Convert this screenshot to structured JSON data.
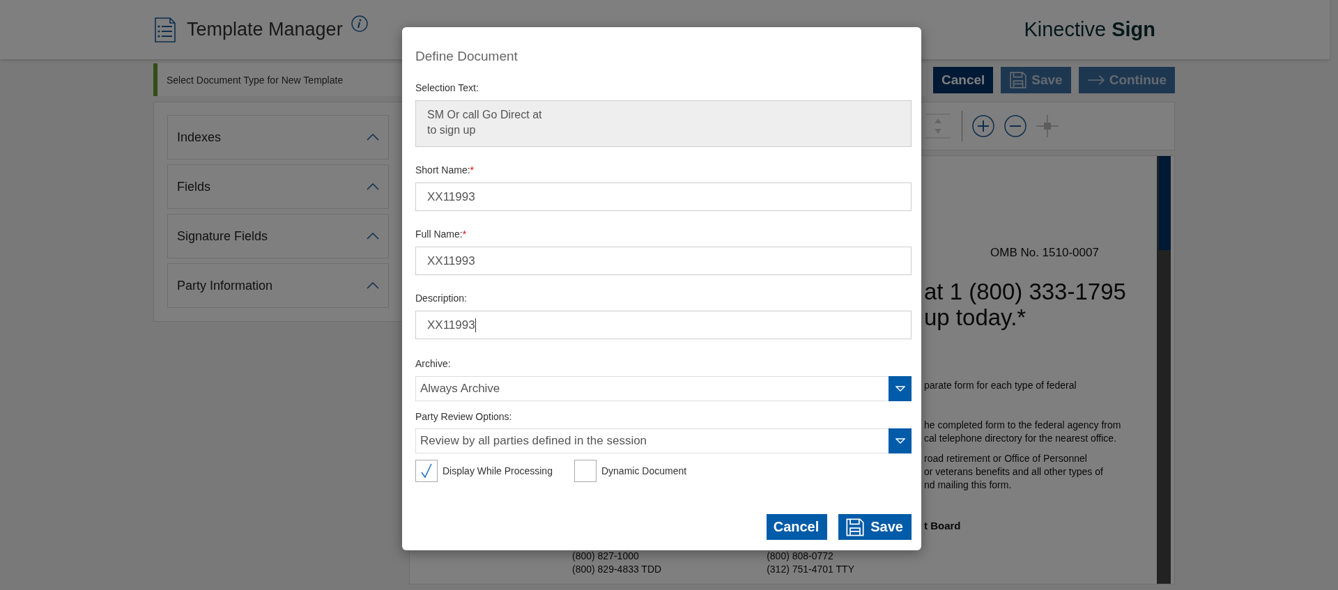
{
  "header": {
    "title": "Template Manager",
    "logo": {
      "light": "Kinective",
      "bold": "Sign"
    }
  },
  "step_bar": {
    "text": "Select Document Type for New Template"
  },
  "actions": [
    {
      "label": "Cancel",
      "kind": "cancel",
      "disabled": false
    },
    {
      "label": "Save",
      "kind": "save",
      "disabled": true
    },
    {
      "label": "Continue",
      "kind": "continue",
      "disabled": true
    }
  ],
  "sidebar": {
    "sections": [
      {
        "label": "Indexes",
        "expanded": true
      },
      {
        "label": "Fields",
        "expanded": true
      },
      {
        "label": "Signature Fields",
        "expanded": true
      },
      {
        "label": "Party Information",
        "expanded": true
      }
    ]
  },
  "document": {
    "lines": [
      {
        "kind": "omb",
        "text": "OMB No. 1510-0007"
      },
      {
        "kind": "heading",
        "text": "at 1 (800) 333-1795"
      },
      {
        "kind": "heading",
        "text": "up today.*"
      },
      {
        "kind": "body",
        "text": "parate form for each type of federal"
      },
      {
        "kind": "gap",
        "text": "he completed form to the federal agency from"
      },
      {
        "kind": "body",
        "text": "cal telephone directory for the nearest office."
      },
      {
        "kind": "para",
        "text": "road retirement or Office of Personnel"
      },
      {
        "kind": "body",
        "text": "or veterans benefits and all other types of"
      },
      {
        "kind": "body",
        "text": "nd mailing this form."
      },
      {
        "kind": "bold",
        "text": "t Board"
      }
    ],
    "contacts": [
      {
        "lines": [
          "(800) 827-1000",
          "(800) 829-4833 TDD"
        ]
      },
      {
        "lines": [
          "(800) 808-0772",
          "(312) 751-4701 TTY"
        ]
      }
    ]
  },
  "dialog": {
    "title": "Define Document",
    "fields": [
      {
        "kind": "readonly",
        "label": "Selection Text:",
        "value": "SM Or call Go Direct at\nto sign up"
      },
      {
        "kind": "text",
        "label": "Short Name:",
        "required_mark": "*",
        "value": "XX11993",
        "focused": false
      },
      {
        "kind": "text",
        "label": "Full Name:",
        "required_mark": "*",
        "value": "XX11993",
        "focused": false
      },
      {
        "kind": "text",
        "label": "Description:",
        "value": "XX11993",
        "focused": true
      },
      {
        "kind": "select",
        "label": "Archive:",
        "value": "Always Archive"
      },
      {
        "kind": "select",
        "label": "Party Review Options:",
        "value": "Review by all parties defined in the session"
      }
    ],
    "checkboxes": [
      {
        "label": "Display While Processing",
        "checked": true
      },
      {
        "label": "Dynamic Document",
        "checked": false
      }
    ],
    "buttons": [
      {
        "label": "Cancel",
        "kind": "cancel"
      },
      {
        "label": "Save",
        "kind": "save"
      }
    ]
  }
}
